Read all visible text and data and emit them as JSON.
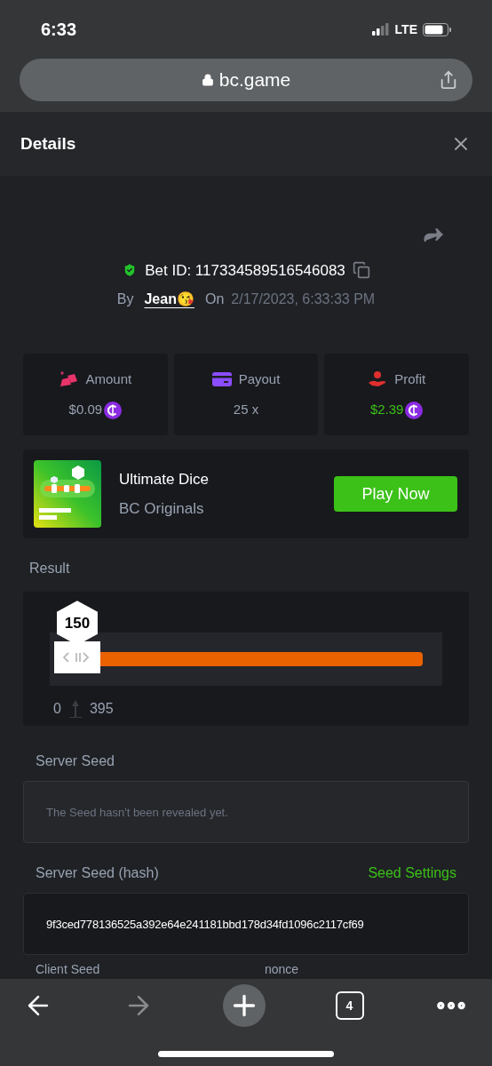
{
  "status_bar": {
    "time": "6:33",
    "network": "LTE"
  },
  "browser": {
    "url": "bc.game"
  },
  "header": {
    "title": "Details"
  },
  "bet": {
    "id_label": "Bet ID: 117334589516546083",
    "by_label": "By",
    "user": "Jean😘",
    "on_label": "On",
    "date": "2/17/2023, 6:33:33 PM"
  },
  "stats": [
    {
      "kind": "amount",
      "label": "Amount",
      "value": "$0.09",
      "coin": true,
      "positive": false
    },
    {
      "kind": "payout",
      "label": "Payout",
      "value": "25 x",
      "coin": false,
      "positive": false
    },
    {
      "kind": "profit",
      "label": "Profit",
      "value": "$2.39",
      "coin": true,
      "positive": true
    }
  ],
  "game": {
    "name": "Ultimate Dice",
    "provider": "BC Originals",
    "button": "Play Now"
  },
  "result": {
    "title": "Result",
    "value": "150",
    "level": 0.07,
    "min": "0",
    "max": "395"
  },
  "server_seed": {
    "label": "Server Seed",
    "placeholder": "The Seed hasn't been revealed yet."
  },
  "server_seed_hash": {
    "label": "Server Seed (hash)",
    "link": "Seed Settings",
    "value": "9f3ced778136525a392e64e241181bbd178d34fd1096c2117cf69"
  },
  "client_seed": {
    "label": "Client Seed",
    "nonce_label": "nonce"
  },
  "toolbar": {
    "tab_count": "4"
  }
}
